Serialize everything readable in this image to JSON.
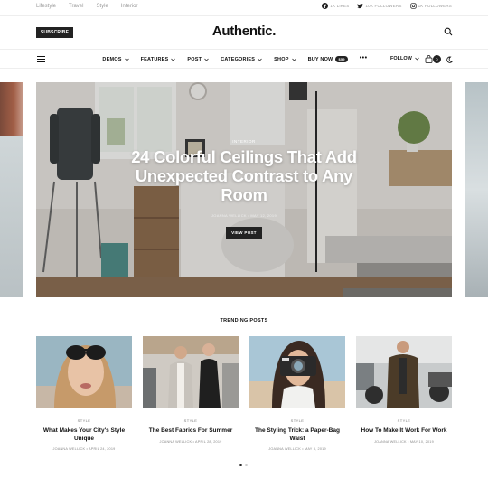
{
  "topbar": {
    "links": [
      "Lifestyle",
      "Travel",
      "Style",
      "Interior"
    ],
    "socials": [
      {
        "icon": "facebook-icon",
        "label": "1K LIKES"
      },
      {
        "icon": "twitter-icon",
        "label": "10K FOLLOWERS"
      },
      {
        "icon": "instagram-icon",
        "label": "1K FOLLOWERS"
      }
    ]
  },
  "header": {
    "subscribe_label": "SUBSCRIBE",
    "logo": "Authentic."
  },
  "nav": {
    "items": [
      {
        "label": "DEMOS"
      },
      {
        "label": "FEATURES"
      },
      {
        "label": "POST"
      },
      {
        "label": "CATEGORIES"
      },
      {
        "label": "SHOP"
      }
    ],
    "buy_now": "BUY NOW",
    "buy_badge": "$59",
    "more": "•••",
    "follow": "FOLLOW",
    "cart_count": "0"
  },
  "hero": {
    "category": "INTERIOR",
    "title": "24 Colorful Ceilings That Add Unexpected Contrast to Any Room",
    "meta": "JOANNA WELLICK  •  MAY 12, 2019",
    "button": "VIEW POST"
  },
  "trending": {
    "heading": "TRENDING POSTS",
    "posts": [
      {
        "category": "STYLE",
        "title": "What Makes Your City's Style Unique",
        "meta": "JOANNA WELLICK  •  APRIL 24, 2019"
      },
      {
        "category": "STYLE",
        "title": "The Best Fabrics For Summer",
        "meta": "JOANNA WELLICK  •  APRIL 28, 2019"
      },
      {
        "category": "STYLE",
        "title": "The Styling Trick: a Paper-Bag Waist",
        "meta": "JOANNA WELLICK  •  MAY 3, 2019"
      },
      {
        "category": "STYLE",
        "title": "How To Make It Work For Work",
        "meta": "JOANNA WELLICK  •  MAY 10, 2019"
      }
    ]
  },
  "colors": {
    "accent": "#222222",
    "text": "#111111",
    "muted": "#888888"
  }
}
